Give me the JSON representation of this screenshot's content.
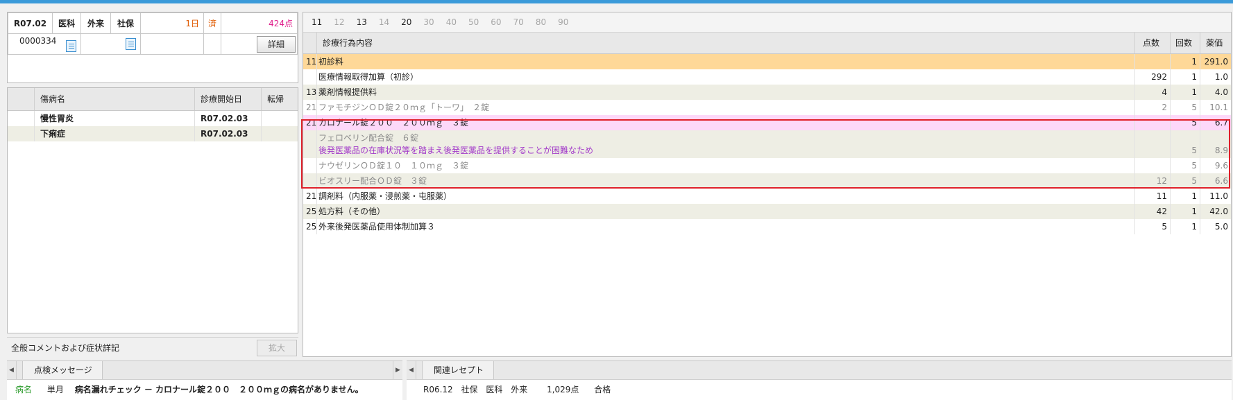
{
  "header": {
    "era_date": "R07.02",
    "dept": "医科",
    "visit": "外来",
    "insurance": "社保",
    "days": "1日",
    "status": "済",
    "points": "424点",
    "patient_id": "0000334",
    "detail_label": "詳細"
  },
  "diseases": {
    "col_name": "傷病名",
    "col_start": "診療開始日",
    "col_outcome": "転帰",
    "rows": [
      {
        "name": "慢性胃炎",
        "start": "R07.02.03",
        "outcome": ""
      },
      {
        "name": "下痢症",
        "start": "R07.02.03",
        "outcome": ""
      }
    ]
  },
  "comment": {
    "label": "全般コメントおよび症状詳記",
    "expand_label": "拡大"
  },
  "filter_tabs": [
    "11",
    "12",
    "13",
    "14",
    "20",
    "30",
    "40",
    "50",
    "60",
    "70",
    "80",
    "90"
  ],
  "active_tabs": [
    "11",
    "13",
    "20"
  ],
  "table": {
    "col_content": "診療行為内容",
    "col_points": "点数",
    "col_count": "回数",
    "col_price": "薬価",
    "rows": [
      {
        "code": "11",
        "text": "初診料",
        "points": "",
        "count": "1",
        "price": "291.0"
      },
      {
        "code": "",
        "text": "医療情報取得加算（初診）",
        "points": "292",
        "count": "1",
        "price": "1.0"
      },
      {
        "code": "13",
        "text": "薬剤情報提供料",
        "points": "4",
        "count": "1",
        "price": "4.0"
      },
      {
        "code": "21",
        "text": "ファモチジンＯＤ錠２０ｍｇ「トーワ」　２錠",
        "points": "2",
        "count": "5",
        "price": "10.1"
      },
      {
        "code": "21",
        "text": "カロナール錠２００　２００ｍｇ　３錠",
        "points": "",
        "count": "5",
        "price": "6.7"
      },
      {
        "code": "",
        "text": "フェロベリン配合錠　６錠",
        "note": "後発医薬品の在庫状況等を踏まえ後発医薬品を提供することが困難なため",
        "points": "",
        "count": "5",
        "price": "8.9"
      },
      {
        "code": "",
        "text": "ナウゼリンＯＤ錠１０　１０ｍｇ　３錠",
        "points": "",
        "count": "5",
        "price": "9.6"
      },
      {
        "code": "",
        "text": "ビオスリー配合ＯＤ錠　３錠",
        "points": "12",
        "count": "5",
        "price": "6.6"
      },
      {
        "code": "21",
        "text": "調剤料（内服薬・浸煎薬・屯服薬）",
        "points": "11",
        "count": "1",
        "price": "11.0"
      },
      {
        "code": "25",
        "text": "処方料（その他）",
        "points": "42",
        "count": "1",
        "price": "42.0"
      },
      {
        "code": "25",
        "text": "外来後発医薬品使用体制加算３",
        "points": "5",
        "count": "1",
        "price": "5.0"
      }
    ]
  },
  "check_panel": {
    "tab_label": "点検メッセージ",
    "category": "病名",
    "period": "単月",
    "message": "病名漏れチェック － カロナール錠２００　２００ｍｇの病名がありません。"
  },
  "related_panel": {
    "tab_label": "関連レセプト",
    "era_date": "R06.12",
    "insurance": "社保",
    "dept": "医科",
    "visit": "外来",
    "points": "1,029点",
    "result": "合格"
  },
  "colors": {
    "accent_bar": "#3a9ad9",
    "row_orange": "#fed898",
    "row_pink": "#fdd8f9",
    "row_beige": "#eeeee4",
    "highlight_border": "#e0202a",
    "note_purple": "#a23ac9"
  }
}
